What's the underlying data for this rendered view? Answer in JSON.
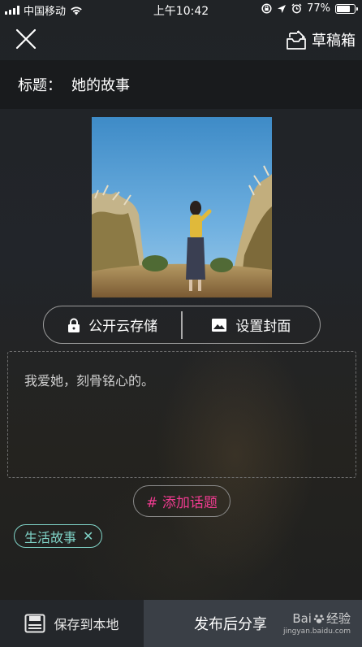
{
  "status_bar": {
    "carrier": "中国移动",
    "time": "上午10:42",
    "battery_percent": "77%",
    "battery_level": 0.77
  },
  "top_nav": {
    "close_icon": "close-icon",
    "drafts_label": "草稿箱",
    "drafts_icon": "drafts-inbox-icon"
  },
  "title_row": {
    "label": "标题：",
    "value": "她的故事"
  },
  "actions": {
    "public_storage_label": "公开云存储",
    "public_storage_icon": "lock-icon",
    "set_cover_label": "设置封面",
    "set_cover_icon": "image-icon"
  },
  "description": {
    "text": "我爱她，刻骨铭心的。"
  },
  "topic": {
    "add_label": "# 添加话题",
    "accent_color": "#ee3b8f"
  },
  "tags": [
    {
      "label": "生活故事",
      "remove": "✕"
    }
  ],
  "bottom_bar": {
    "save_local_label": "保存到本地",
    "save_icon": "save-disk-icon",
    "publish_label": "发布后分享"
  },
  "watermark": {
    "brand": "Bai",
    "brand_suffix": "经验",
    "url": "jingyan.baidu.com"
  }
}
